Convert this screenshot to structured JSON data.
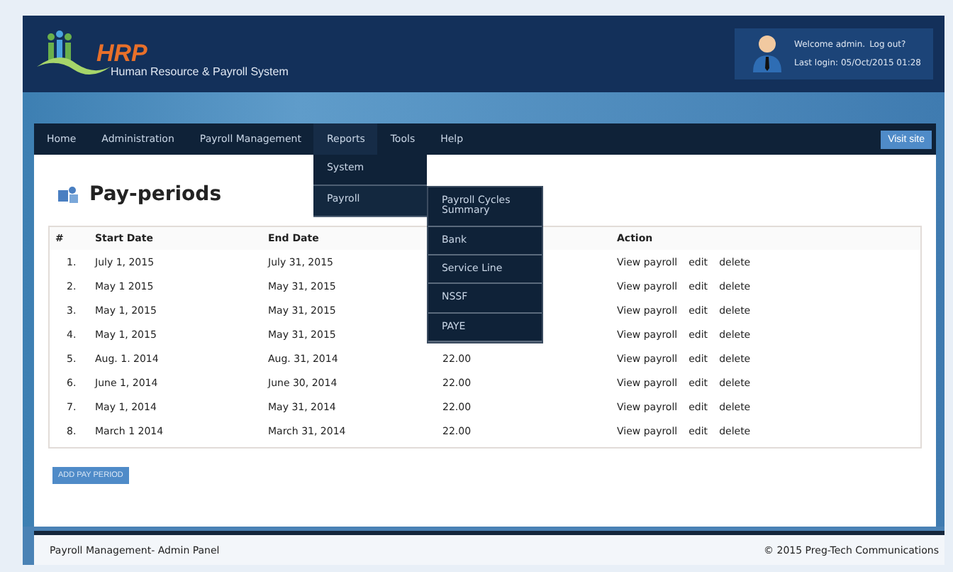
{
  "header": {
    "logo_text": "HRP",
    "subtitle": "Human Resource & Payroll System",
    "welcome": "Welcome admin.",
    "logout": "Log out?",
    "last_login": "Last login: 05/Oct/2015 01:28"
  },
  "nav": {
    "items": [
      {
        "label": "Home",
        "expanded": false
      },
      {
        "label": "Administration",
        "expanded": false
      },
      {
        "label": "Payroll Management",
        "expanded": false
      },
      {
        "label": "Reports",
        "expanded": true,
        "children": [
          {
            "label": "System",
            "expanded": false
          },
          {
            "label": "Payroll",
            "expanded": true,
            "children": [
              {
                "label": "Payroll Cycles Summary",
                "expanded": false
              },
              {
                "label": "Bank",
                "expanded": false
              },
              {
                "label": "Service Line",
                "expanded": false
              },
              {
                "label": "NSSF",
                "expanded": false
              },
              {
                "label": "PAYE",
                "expanded": false
              }
            ]
          }
        ]
      },
      {
        "label": "Tools",
        "expanded": false
      },
      {
        "label": "Help",
        "expanded": false
      }
    ],
    "visit_site": "Visit site"
  },
  "page_title": "Pay-periods",
  "table": {
    "columns": [
      "#",
      "Start Date",
      "End Date",
      "Action"
    ],
    "rows": [
      {
        "index": "1.",
        "start": "July 1, 2015",
        "end": "July 31, 2015",
        "actions": [
          "View payroll",
          "edit",
          "delete"
        ]
      },
      {
        "index": "2.",
        "start": "May 1 2015",
        "end": "May 31, 2015",
        "actions": [
          "View payroll",
          "edit",
          "delete"
        ]
      },
      {
        "index": "3.",
        "start": "May 1, 2015",
        "end": "May 31, 2015",
        "actions": [
          "View payroll",
          "edit",
          "delete"
        ]
      },
      {
        "index": "4.",
        "start": "May 1, 2015",
        "end": "May 31, 2015",
        "actions": [
          "View payroll",
          "edit",
          "delete"
        ]
      },
      {
        "index": "5.",
        "start": "Aug. 1. 2014",
        "end": "Aug. 31, 2014",
        "column_3": "22.00",
        "actions": [
          "View payroll",
          "edit",
          "delete"
        ]
      },
      {
        "index": "6.",
        "start": "June 1, 2014",
        "end": "June 30, 2014",
        "column_3": "22.00",
        "actions": [
          "View payroll",
          "edit",
          "delete"
        ]
      },
      {
        "index": "7.",
        "start": "May 1, 2014",
        "end": "May 31, 2014",
        "column_3": "22.00",
        "actions": [
          "View payroll",
          "edit",
          "delete"
        ]
      },
      {
        "index": "8.",
        "start": "March 1 2014",
        "end": "March 31, 2014",
        "column_3": "22.00",
        "actions": [
          "View payroll",
          "edit",
          "delete"
        ]
      }
    ]
  },
  "add_button": "ADD PAY PERIOD",
  "footer": {
    "left": "Payroll Management- Admin Panel",
    "right": "© 2015 Preg-Tech Communications"
  }
}
